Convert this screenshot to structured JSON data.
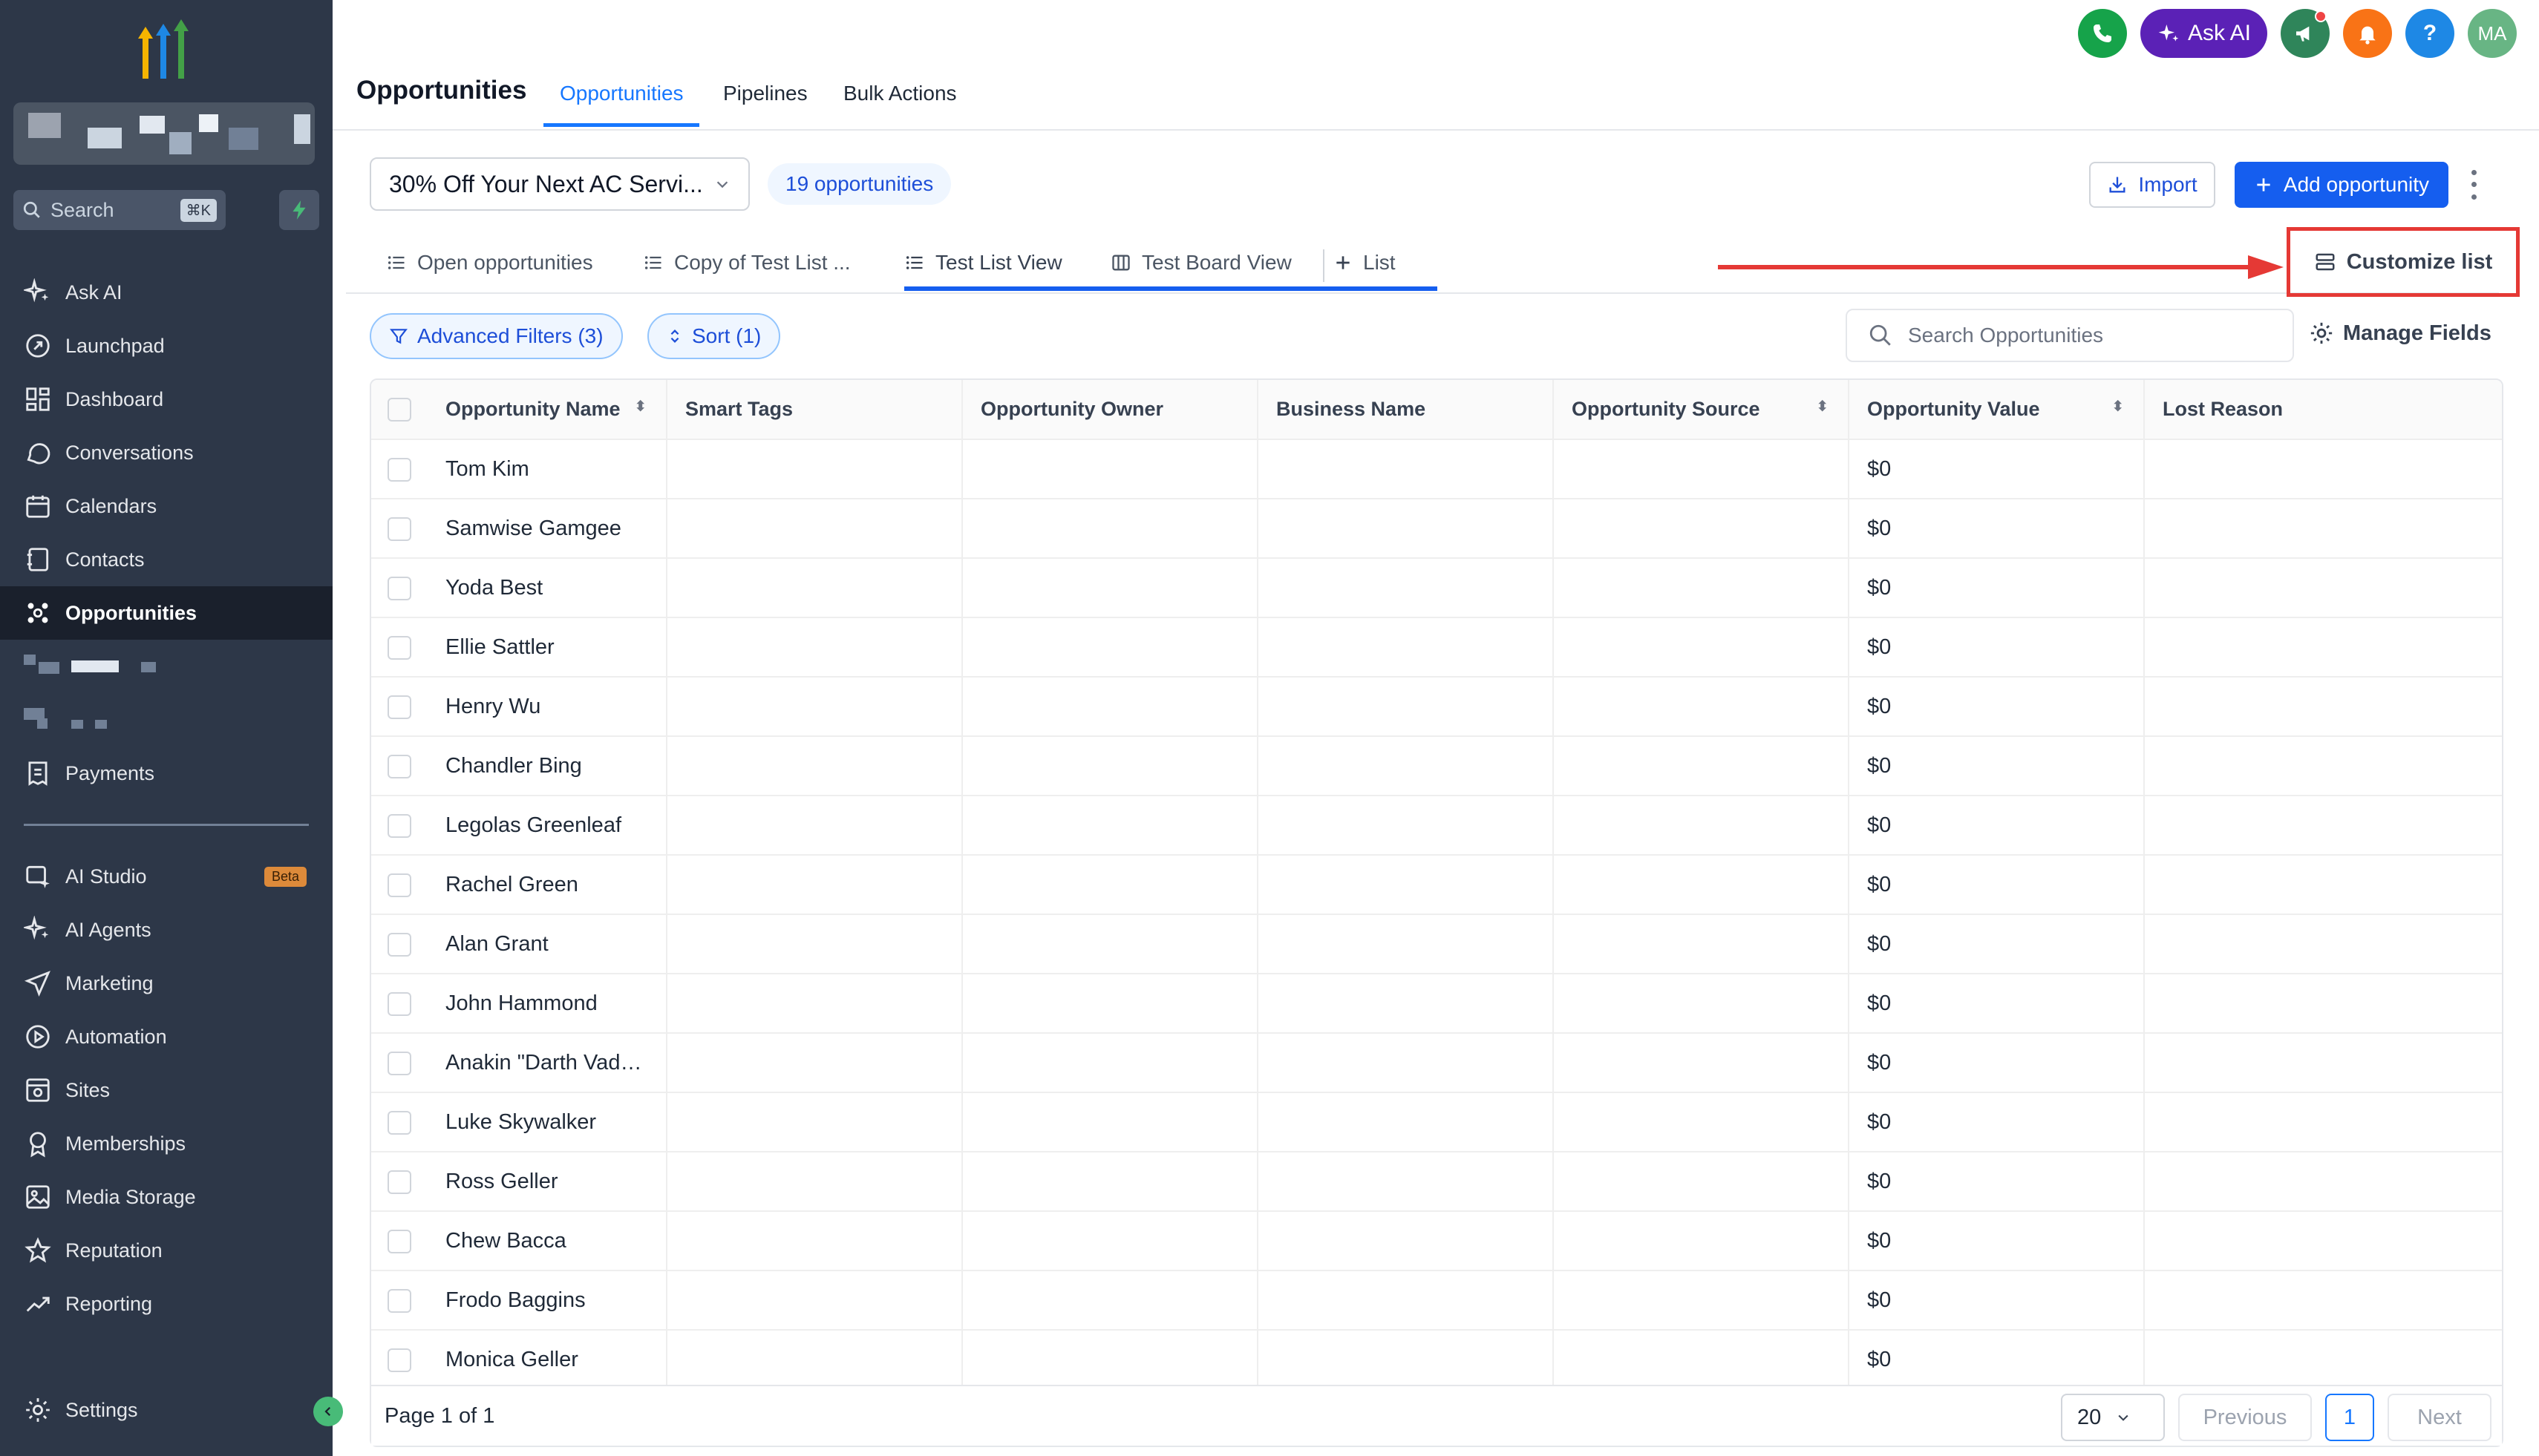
{
  "sidebar": {
    "search_placeholder": "Search",
    "search_shortcut": "⌘K",
    "items_top": [
      {
        "label": "Ask AI",
        "icon": "sparkle-icon"
      },
      {
        "label": "Launchpad",
        "icon": "rocket-icon"
      },
      {
        "label": "Dashboard",
        "icon": "dashboard-icon"
      },
      {
        "label": "Conversations",
        "icon": "chat-icon"
      },
      {
        "label": "Calendars",
        "icon": "calendar-icon"
      },
      {
        "label": "Contacts",
        "icon": "contacts-icon"
      },
      {
        "label": "Opportunities",
        "icon": "opportunities-icon",
        "active": true
      }
    ],
    "payments_label": "Payments",
    "items_bottom": [
      {
        "label": "AI Studio",
        "icon": "ai-studio-icon",
        "badge": "Beta"
      },
      {
        "label": "AI Agents",
        "icon": "sparkle-icon"
      },
      {
        "label": "Marketing",
        "icon": "send-icon"
      },
      {
        "label": "Automation",
        "icon": "automation-icon"
      },
      {
        "label": "Sites",
        "icon": "sites-icon"
      },
      {
        "label": "Memberships",
        "icon": "award-icon"
      },
      {
        "label": "Media Storage",
        "icon": "image-icon"
      },
      {
        "label": "Reputation",
        "icon": "star-icon"
      },
      {
        "label": "Reporting",
        "icon": "trend-icon"
      }
    ],
    "settings_label": "Settings"
  },
  "header": {
    "title": "Opportunities",
    "tabs": [
      "Opportunities",
      "Pipelines",
      "Bulk Actions"
    ],
    "ask_ai_label": "Ask AI",
    "avatar_initials": "MA",
    "help_glyph": "?"
  },
  "toolbar": {
    "pipeline": "30% Off Your Next AC Servi...",
    "count": "19 opportunities",
    "import_label": "Import",
    "add_label": "Add opportunity"
  },
  "views": {
    "tabs": [
      "Open opportunities",
      "Copy of Test List ...",
      "Test List View",
      "Test Board View",
      "List"
    ],
    "customize_label": "Customize list"
  },
  "filters": {
    "advanced": "Advanced Filters (3)",
    "sort": "Sort (1)",
    "search_placeholder": "Search Opportunities",
    "manage_fields": "Manage Fields"
  },
  "table": {
    "columns": [
      "Opportunity Name",
      "Smart Tags",
      "Opportunity Owner",
      "Business Name",
      "Opportunity Source",
      "Opportunity Value",
      "Lost Reason"
    ],
    "rows": [
      {
        "name": "Tom Kim",
        "value": "$0"
      },
      {
        "name": "Samwise Gamgee",
        "value": "$0"
      },
      {
        "name": "Yoda Best",
        "value": "$0"
      },
      {
        "name": "Ellie Sattler",
        "value": "$0"
      },
      {
        "name": "Henry Wu",
        "value": "$0"
      },
      {
        "name": "Chandler Bing",
        "value": "$0"
      },
      {
        "name": "Legolas Greenleaf",
        "value": "$0"
      },
      {
        "name": "Rachel Green",
        "value": "$0"
      },
      {
        "name": "Alan Grant",
        "value": "$0"
      },
      {
        "name": "John Hammond",
        "value": "$0"
      },
      {
        "name": "Anakin \"Darth Vader\" Sk...",
        "value": "$0"
      },
      {
        "name": "Luke Skywalker",
        "value": "$0"
      },
      {
        "name": "Ross Geller",
        "value": "$0"
      },
      {
        "name": "Chew Bacca",
        "value": "$0"
      },
      {
        "name": "Frodo Baggins",
        "value": "$0"
      },
      {
        "name": "Monica Geller",
        "value": "$0"
      }
    ]
  },
  "pagination": {
    "page_info": "Page 1 of 1",
    "per_page": "20",
    "previous": "Previous",
    "current": "1",
    "next": "Next"
  },
  "colors": {
    "sidebar_bg": "#2d3748",
    "accent": "#155eef",
    "annotation_red": "#e53935"
  }
}
